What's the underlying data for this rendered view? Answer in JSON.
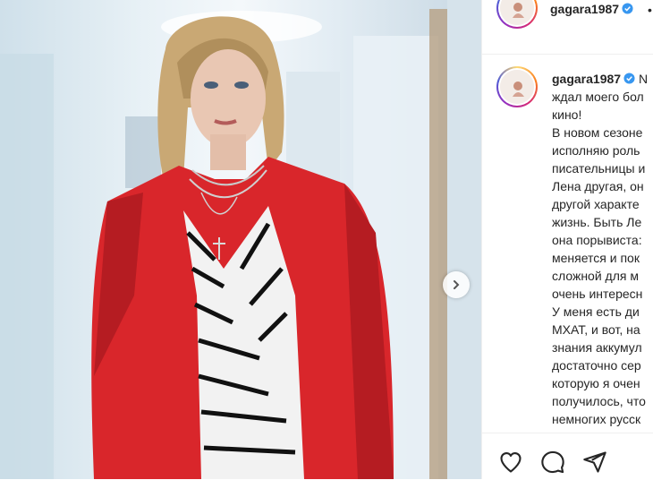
{
  "post": {
    "username": "gagara1987",
    "header_more": "•",
    "caption_lines": [
      "ждал моего бол",
      "кино!",
      "В новом сезоне",
      "исполняю роль",
      "писательницы и",
      "Лена другая, он",
      "другой характе",
      "жизнь. Быть Ле",
      "она порывиста:",
      "меняется и пок",
      "сложной для м",
      "очень интересн",
      "У меня есть ди",
      "МХАТ, и вот, на",
      "знания аккумул",
      "достаточно сер",
      "которую я очен",
      "получилось, что",
      "немногих русск"
    ],
    "caption_first_letter": "N"
  },
  "colors": {
    "verified": "#3897f0",
    "jacket": "#d9262b"
  },
  "icons": {
    "like": "heart-icon",
    "comment": "comment-icon",
    "share": "paper-plane-icon",
    "next": "chevron-right-icon"
  }
}
